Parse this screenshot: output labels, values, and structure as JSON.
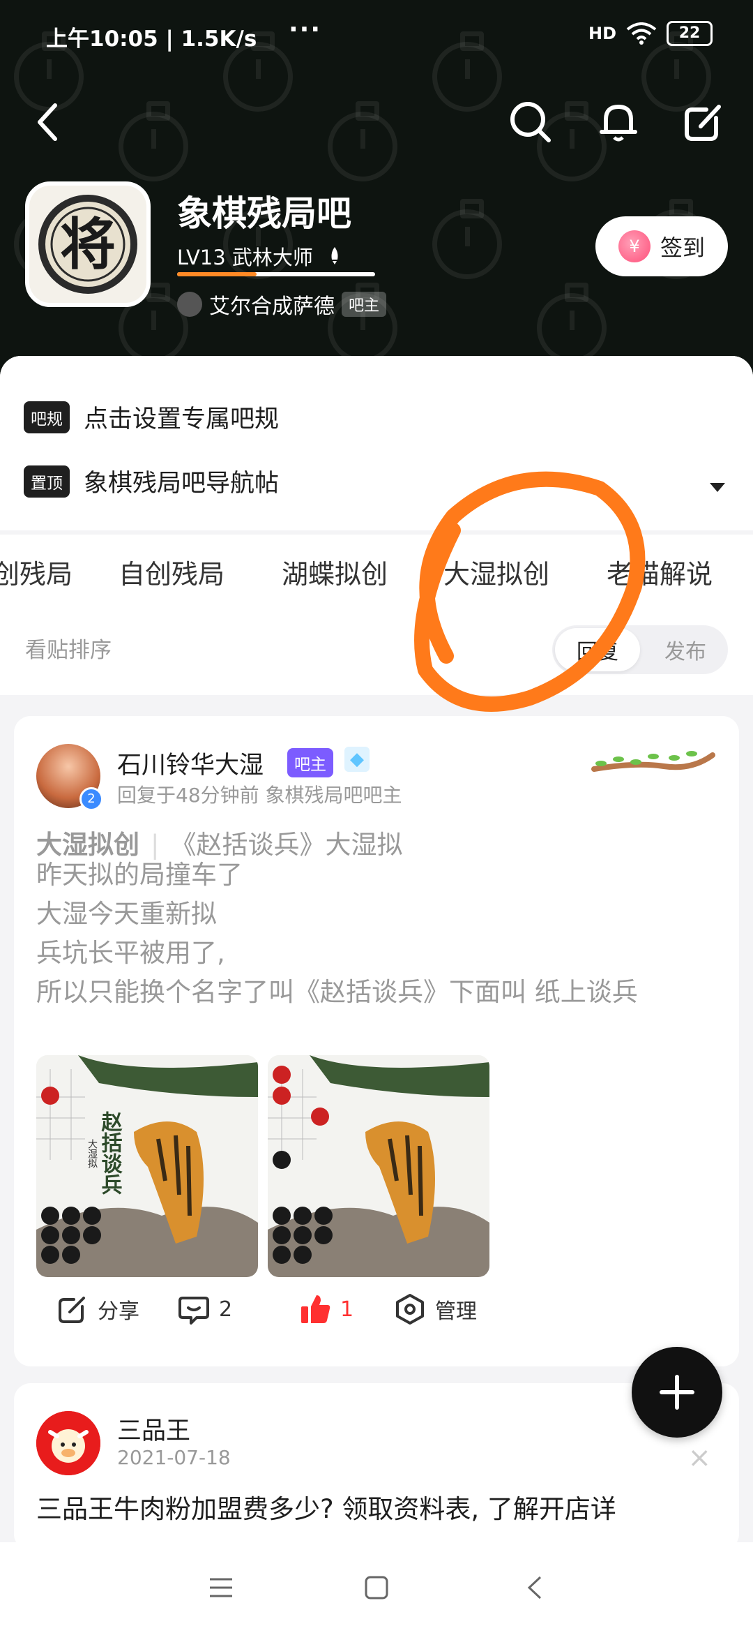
{
  "status_bar": {
    "time_speed": "上午10:05 | 1.5K/s",
    "more": "···",
    "signal_label": "HD",
    "battery": "22"
  },
  "top_bar": {
    "back_icon": "chevron-left-icon",
    "search_icon": "search-icon",
    "bell_icon": "bell-icon",
    "edit_icon": "compose-icon"
  },
  "forum": {
    "avatar_char": "将",
    "name": "象棋残局吧",
    "level": "LV13 武林大师",
    "owner_name": "艾尔合成萨德",
    "owner_tag": "吧主",
    "sign_label": "签到",
    "sign_coin": "¥"
  },
  "notices": [
    {
      "tag": "吧规",
      "text": "点击设置专属吧规"
    },
    {
      "tag": "置顶",
      "text": "象棋残局吧导航帖"
    }
  ],
  "tabs": [
    "创残局",
    "自创残局",
    "湖蝶拟创",
    "大湿拟创",
    "老猫解说"
  ],
  "sort": {
    "label": "看贴排序",
    "options": [
      "回复",
      "发布"
    ],
    "active": "回复"
  },
  "post1": {
    "author": "石川铃华大湿",
    "badge": "吧主",
    "verified": "2",
    "meta": "回复于48分钟前   象棋残局吧吧主",
    "title_tag": "大湿拟创",
    "title": "《赵括谈兵》大湿拟",
    "body": [
      "昨天拟的局撞车了",
      "大湿今天重新拟",
      "兵坑长平被用了,",
      "所以只能换个名字了叫《赵括谈兵》下面叫 纸上谈兵"
    ],
    "img1_text": "赵括谈兵",
    "img1_sub": "大湿拟",
    "actions": {
      "share": "分享",
      "comment_count": "2",
      "like_count": "1",
      "manage": "管理"
    }
  },
  "post2": {
    "author": "三品王",
    "date": "2021-07-18",
    "close": "×",
    "text": "三品王牛肉粉加盟费多少? 领取资料表, 了解开店详"
  },
  "colors": {
    "header_bg": "#0e1410",
    "accent_orange": "#ff7a1a",
    "like_red": "#ff3030",
    "badge_purple": "#7c5cff"
  }
}
